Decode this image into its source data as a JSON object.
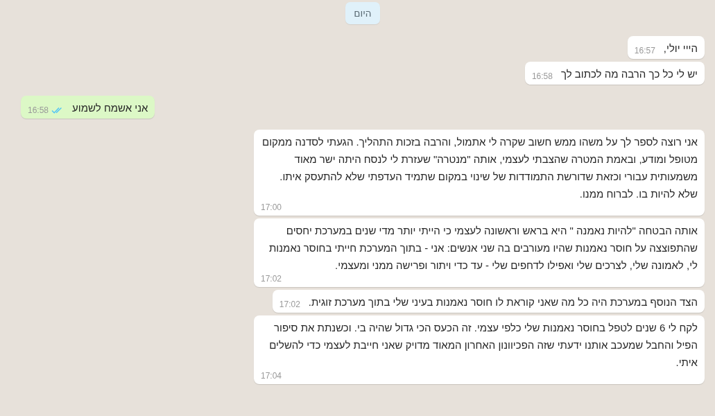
{
  "date_chip": "היום",
  "messages": [
    {
      "kind": "in",
      "text": "הייי יולי,",
      "time": "16:57"
    },
    {
      "kind": "in",
      "text": "יש לי כל כך הרבה מה לכתוב לך",
      "time": "16:58"
    },
    {
      "kind": "out",
      "text": "אני אשמח לשמוע",
      "time": "16:58",
      "read": true
    },
    {
      "kind": "in",
      "text": "אני רוצה לספר לך על משהו ממש חשוב שקרה לי אתמול, והרבה בזכות התהליך. הגעתי לסדנה ממקום מטופל ומודע, ובאמת המטרה שהצבתי לעצמי, אותה \"מנטרה\" שעזרת לי לנסח היתה ישר מאוד משמעותית עבורי וכזאת שדורשת התמודדות של שינוי במקום שתמיד העדפתי שלא להתעסק איתו. שלא להיות בו. לברוח ממנו.",
      "time": "17:00"
    },
    {
      "kind": "in",
      "text": "אותה הבטחה \"להיות נאמנה \" היא בראש וראשונה לעצמי כי הייתי יותר מדי שנים במערכת יחסים שהתפוצצה על חוסר נאמנות שהיו מעורבים בה שני אנשים: אני - בתוך המערכת חייתי בחוסר נאמנות לי, לאמונה שלי, לצרכים שלי ואפילו לדחפים שלי - עד כדי ויתור ופרישה ממני ומעצמי.",
      "time": "17:02"
    },
    {
      "kind": "in",
      "text": "הצד הנוסף במערכת היה כל מה שאני קוראת לו חוסר נאמנות בעיני שלי בתוך מערכת זוגית.",
      "time": "17:02"
    },
    {
      "kind": "in",
      "text": "לקח לי 6 שנים לטפל בחוסר נאמנות שלי כלפי עצמי. זה הכעס הכי גדול שהיה בי. וכשנתת את סיפור הפיל והחבל שמעכב אותנו ידעתי שזה הפכיוונון האחרון המאוד מדויק שאני חייבת לעצמי כדי להשלים איתי.",
      "time": "17:04"
    }
  ]
}
